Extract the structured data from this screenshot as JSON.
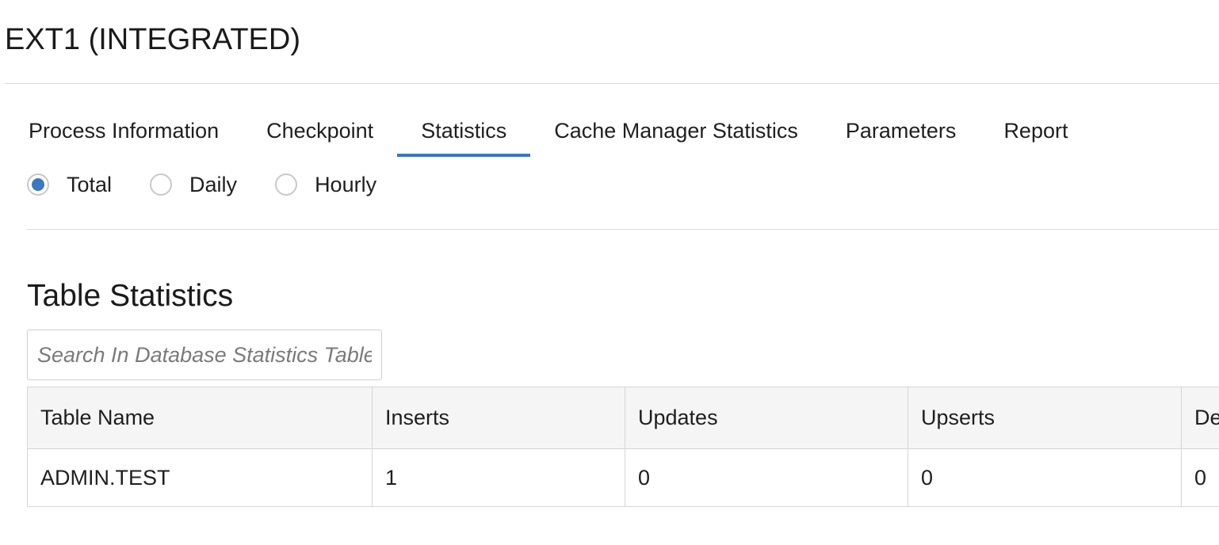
{
  "page_title": "EXT1 (INTEGRATED)",
  "tabs": [
    {
      "label": "Process Information",
      "active": false
    },
    {
      "label": "Checkpoint",
      "active": false
    },
    {
      "label": "Statistics",
      "active": true
    },
    {
      "label": "Cache Manager Statistics",
      "active": false
    },
    {
      "label": "Parameters",
      "active": false
    },
    {
      "label": "Report",
      "active": false
    }
  ],
  "interval_options": [
    {
      "label": "Total",
      "selected": true
    },
    {
      "label": "Daily",
      "selected": false
    },
    {
      "label": "Hourly",
      "selected": false
    }
  ],
  "section": {
    "heading": "Table Statistics"
  },
  "search": {
    "placeholder": "Search In Database Statistics Table",
    "value": ""
  },
  "table": {
    "columns": [
      "Table Name",
      "Inserts",
      "Updates",
      "Upserts",
      "Deletes"
    ],
    "rows": [
      [
        "ADMIN.TEST",
        "1",
        "0",
        "0",
        "0"
      ]
    ]
  },
  "colors": {
    "accent": "#3a78bf",
    "header_bg": "#f5f5f5",
    "border": "#d6d6d6"
  }
}
